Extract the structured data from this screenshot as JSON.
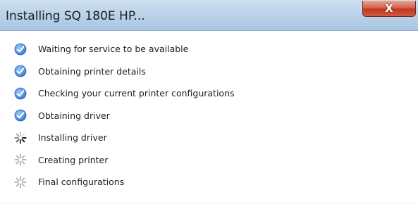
{
  "window": {
    "title": "Installing SQ 180E HP...",
    "close_label": "X"
  },
  "steps": [
    {
      "label": "Waiting for service to be available",
      "status": "done",
      "icon": "checkmark-icon"
    },
    {
      "label": "Obtaining printer details",
      "status": "done",
      "icon": "checkmark-icon"
    },
    {
      "label": "Checking your current printer configurations",
      "status": "done",
      "icon": "checkmark-icon"
    },
    {
      "label": "Obtaining driver",
      "status": "done",
      "icon": "checkmark-icon"
    },
    {
      "label": "Installing driver",
      "status": "in-progress",
      "icon": "spinner-icon"
    },
    {
      "label": "Creating printer",
      "status": "pending",
      "icon": "spinner-pending-icon"
    },
    {
      "label": "Final configurations",
      "status": "pending",
      "icon": "spinner-pending-icon"
    }
  ],
  "colors": {
    "check_fill": "#3a7bd5",
    "spinner_active": "#1a1a1a",
    "spinner_pending": "#b8b8b8",
    "close_red": "#c9452c"
  }
}
